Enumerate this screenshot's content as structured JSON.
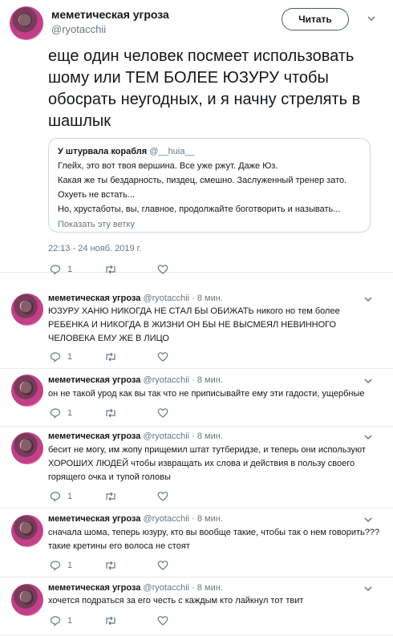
{
  "main_tweet": {
    "author_name": "меметическая угроза",
    "author_handle": "@ryotacchii",
    "follow_label": "Читать",
    "text": "еще один человек посмеет использовать шому или ТЕМ БОЛЕЕ ЮЗУРУ чтобы обосрать неугодных, и я начну стрелять в шашлык",
    "quote": {
      "name": "У штурвала корабля",
      "handle": "@__huia__",
      "lines": [
        "Глейх, это вот твоя вершина. Все уже ржут. Даже Юз.",
        "Какая же ты бездарность, пиздец, смешно. Заслуженный тренер зато.",
        "Охуеть не встать...",
        "Но, хрустаботы, вы, главное, продолжайте боготворить и называть..."
      ],
      "show_thread": "Показать эту ветку"
    },
    "timestamp": "22:13 - 24 нояб. 2019 г.",
    "reply_count": "1"
  },
  "replies": [
    {
      "name": "меметическая угроза",
      "handle": "@ryotacchii",
      "time": "· 8 мин.",
      "text": "ЮЗУРУ ХАНЮ НИКОГДА НЕ СТАЛ БЫ ОБИЖАТЬ никого но тем более РЕБЕНКА И НИКОГДА В ЖИЗНИ ОН БЫ НЕ ВЫСМЕЯЛ НЕВИННОГО ЧЕЛОВЕКА ЕМУ ЖЕ В ЛИЦО",
      "reply_count": "1"
    },
    {
      "name": "меметическая угроза",
      "handle": "@ryotacchii",
      "time": "· 8 мин.",
      "text": "он не такой урод как вы так что не приписывайте ему эти гадости, ущербные",
      "reply_count": "1"
    },
    {
      "name": "меметическая угроза",
      "handle": "@ryotacchii",
      "time": "· 8 мин.",
      "text": "бесит не могу, им жопу прищемил штат тутберидзе, и теперь они используют ХОРОШИХ ЛЮДЕЙ чтобы извращать их слова и действия в пользу своего горящего очка и тупой головы",
      "reply_count": "1"
    },
    {
      "name": "меметическая угроза",
      "handle": "@ryotacchii",
      "time": "· 8 мин.",
      "text": "сначала шома, теперь юзуру, кто вы вообще такие, чтобы так о нем говорить??? такие кретины его волоса не стоят",
      "reply_count": "1"
    },
    {
      "name": "меметическая угроза",
      "handle": "@ryotacchii",
      "time": "· 8 мин.",
      "text": "хочется подраться за его честь с каждым кто лайкнул тот твит",
      "reply_count": "1"
    }
  ]
}
